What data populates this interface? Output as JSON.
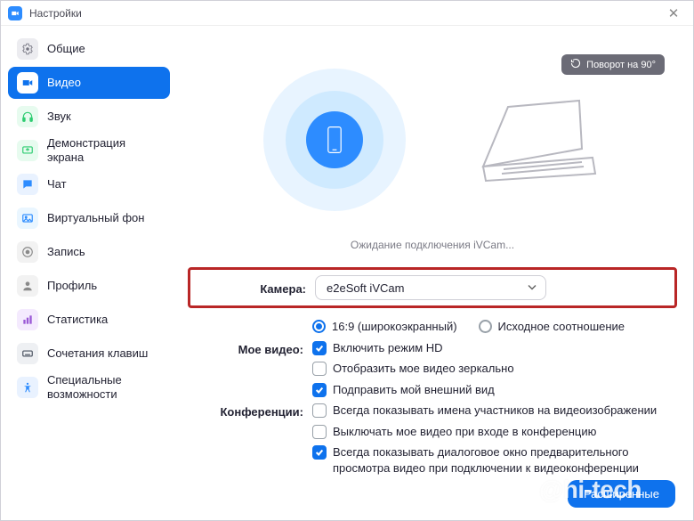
{
  "window": {
    "title": "Настройки",
    "close_glyph": "✕"
  },
  "sidebar": {
    "items": [
      {
        "key": "general",
        "label": "Общие",
        "icon": "gear-icon",
        "bg": "#ececf0",
        "fg": "#747480"
      },
      {
        "key": "video",
        "label": "Видео",
        "icon": "camera-icon",
        "bg": "#ffffff",
        "fg": "#0e72ed",
        "active": true
      },
      {
        "key": "audio",
        "label": "Звук",
        "icon": "headphones-icon",
        "bg": "#e7fbef",
        "fg": "#2ecc71"
      },
      {
        "key": "share",
        "label": "Демонстрация экрана",
        "icon": "screen-icon",
        "bg": "#e7fbef",
        "fg": "#2ecc71"
      },
      {
        "key": "chat",
        "label": "Чат",
        "icon": "chat-icon",
        "bg": "#e9f2ff",
        "fg": "#2d8cff"
      },
      {
        "key": "vbg",
        "label": "Виртуальный фон",
        "icon": "image-icon",
        "bg": "#eaf6ff",
        "fg": "#2d8cff"
      },
      {
        "key": "record",
        "label": "Запись",
        "icon": "record-icon",
        "bg": "#f2f2f2",
        "fg": "#8a8a8a"
      },
      {
        "key": "profile",
        "label": "Профиль",
        "icon": "profile-icon",
        "bg": "#f2f2f2",
        "fg": "#8a8a8a"
      },
      {
        "key": "stats",
        "label": "Статистика",
        "icon": "stats-icon",
        "bg": "#f4eafe",
        "fg": "#9b59d6"
      },
      {
        "key": "keys",
        "label": "Сочетания клавиш",
        "icon": "keyboard-icon",
        "bg": "#eef0f3",
        "fg": "#4a5260"
      },
      {
        "key": "access",
        "label": "Специальные возможности",
        "icon": "access-icon",
        "bg": "#e9f2ff",
        "fg": "#2d8cff"
      }
    ]
  },
  "video": {
    "rotate_label": "Поворот на 90°",
    "waiting_text": "Ожидание подключения iVCam...",
    "camera_label": "Камера:",
    "camera_value": "e2eSoft iVCam",
    "aspect": {
      "wide": "16:9 (широкоэкранный)",
      "original": "Исходное соотношение",
      "selected": "wide"
    },
    "myvideo_label": "Мое видео:",
    "myvideo": {
      "hd": {
        "label": "Включить режим HD",
        "checked": true
      },
      "mirror": {
        "label": "Отобразить мое видео зеркально",
        "checked": false
      },
      "touchup": {
        "label": "Подправить мой внешний вид",
        "checked": true
      }
    },
    "meetings_label": "Конференции:",
    "meetings": {
      "names": {
        "label": "Всегда показывать имена участников на видеоизображении",
        "checked": false
      },
      "offjoin": {
        "label": "Выключать мое видео при входе в конференцию",
        "checked": false
      },
      "preview": {
        "label": "Всегда показывать диалоговое окно предварительного просмотра видео при подключении к видеоконференции",
        "checked": true
      }
    },
    "advanced_label": "Расширенные"
  },
  "watermark": "hi-tech"
}
